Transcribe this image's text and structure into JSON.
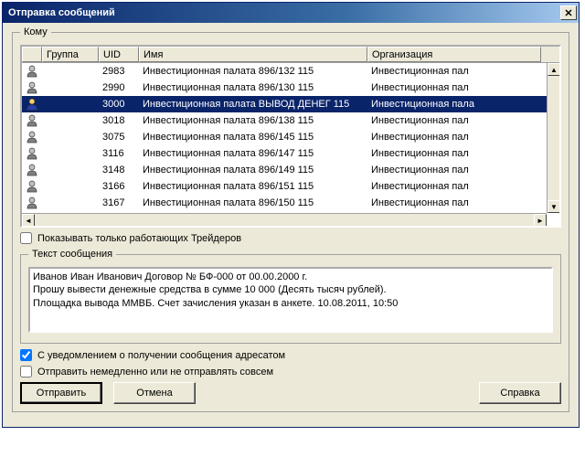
{
  "window": {
    "title": "Отправка сообщений"
  },
  "toWhom": {
    "legend": "Кому",
    "headers": {
      "group": "Группа",
      "uid": "UID",
      "name": "Имя",
      "org": "Организация"
    },
    "rows": [
      {
        "uid": "2983",
        "name": "Инвестиционная палата 896/132 115",
        "org": "Инвестиционная пал",
        "selected": false,
        "highlight": false
      },
      {
        "uid": "2990",
        "name": "Инвестиционная палата 896/130 115",
        "org": "Инвестиционная пал",
        "selected": false,
        "highlight": false
      },
      {
        "uid": "3000",
        "name": "Инвестиционная палата ВЫВОД ДЕНЕГ 115",
        "org": "Инвестиционная пала",
        "selected": true,
        "highlight": true
      },
      {
        "uid": "3018",
        "name": "Инвестиционная палата 896/138 115",
        "org": "Инвестиционная пал",
        "selected": false,
        "highlight": false
      },
      {
        "uid": "3075",
        "name": "Инвестиционная палата 896/145 115",
        "org": "Инвестиционная пал",
        "selected": false,
        "highlight": false
      },
      {
        "uid": "3116",
        "name": "Инвестиционная палата 896/147 115",
        "org": "Инвестиционная пал",
        "selected": false,
        "highlight": false
      },
      {
        "uid": "3148",
        "name": "Инвестиционная палата 896/149 115",
        "org": "Инвестиционная пал",
        "selected": false,
        "highlight": false
      },
      {
        "uid": "3166",
        "name": "Инвестиционная палата 896/151 115",
        "org": "Инвестиционная пал",
        "selected": false,
        "highlight": false
      },
      {
        "uid": "3167",
        "name": "Инвестиционная палата 896/150 115",
        "org": "Инвестиционная пал",
        "selected": false,
        "highlight": false
      }
    ]
  },
  "showOnly": {
    "label": "Показывать только работающих Трейдеров",
    "checked": false
  },
  "message": {
    "legend": "Текст сообщения",
    "text": "Иванов Иван Иванович Договор № БФ-000 от 00.00.2000 г.\nПрошу вывести денежные средства в сумме 10 000 (Десять тысяч рублей).\nПлощадка вывода ММВБ. Счет зачисления указан в анкете. 10.08.2011, 10:50"
  },
  "receipt": {
    "label": "С уведомлением о получении сообщения адресатом",
    "checked": true
  },
  "sendNow": {
    "label": "Отправить немедленно или не отправлять совсем",
    "checked": false
  },
  "buttons": {
    "send": "Отправить",
    "cancel": "Отмена",
    "help": "Справка"
  }
}
